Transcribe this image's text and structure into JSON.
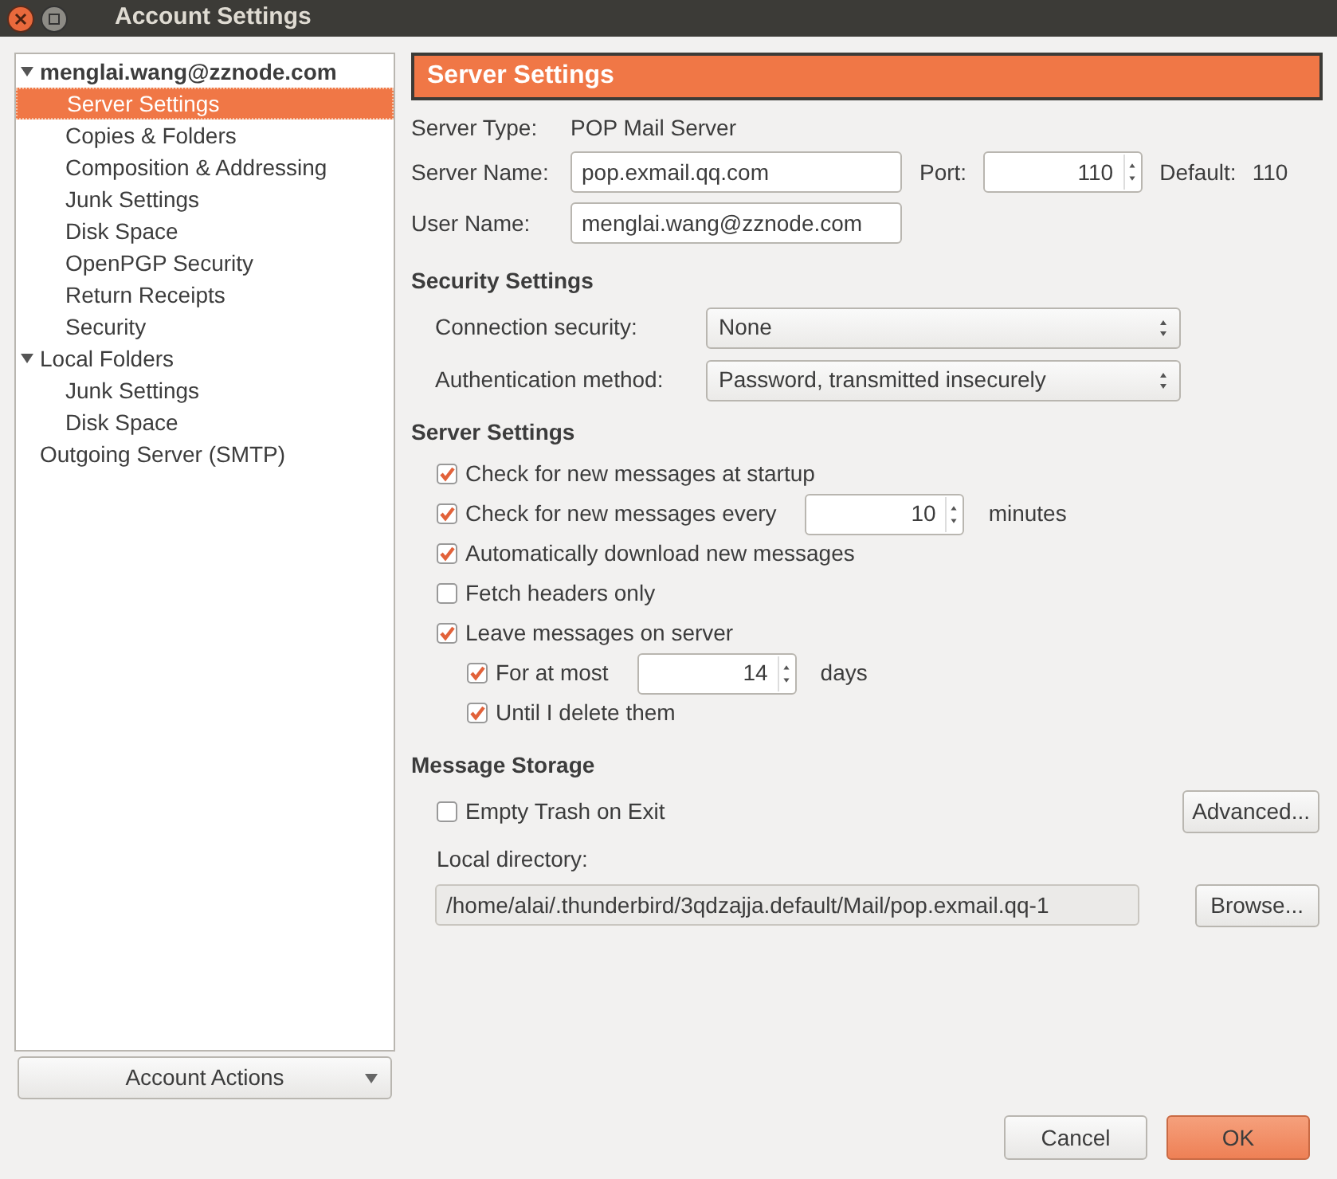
{
  "window": {
    "title": "Account Settings"
  },
  "sidebar": {
    "tree": [
      {
        "label": "menglai.wang@zznode.com",
        "expanded": true,
        "selected": false,
        "children": [
          {
            "label": "Server Settings",
            "selected": true
          },
          {
            "label": "Copies & Folders",
            "selected": false
          },
          {
            "label": "Composition & Addressing",
            "selected": false
          },
          {
            "label": "Junk Settings",
            "selected": false
          },
          {
            "label": "Disk Space",
            "selected": false
          },
          {
            "label": "OpenPGP Security",
            "selected": false
          },
          {
            "label": "Return Receipts",
            "selected": false
          },
          {
            "label": "Security",
            "selected": false
          }
        ]
      },
      {
        "label": "Local Folders",
        "expanded": true,
        "selected": false,
        "children": [
          {
            "label": "Junk Settings",
            "selected": false
          },
          {
            "label": "Disk Space",
            "selected": false
          }
        ]
      },
      {
        "label": "Outgoing Server (SMTP)",
        "selected": false
      }
    ],
    "account_actions": "Account Actions"
  },
  "panel": {
    "title": "Server Settings",
    "server_type": {
      "label": "Server Type:",
      "value": "POP Mail Server"
    },
    "server_name": {
      "label": "Server Name:",
      "value": "pop.exmail.qq.com"
    },
    "port": {
      "label": "Port:",
      "value": "110",
      "default_label": "Default:",
      "default_value": "110"
    },
    "user_name": {
      "label": "User Name:",
      "value": "menglai.wang@zznode.com"
    },
    "security": {
      "heading": "Security Settings",
      "selects": [
        {
          "label": "Connection security:",
          "value": "None"
        },
        {
          "label": "Authentication method:",
          "value": "Password, transmitted insecurely"
        }
      ]
    },
    "server_settings": {
      "heading": "Server Settings",
      "options": [
        {
          "kind": "checkbox",
          "label": "Check for new messages at startup",
          "checked": true
        },
        {
          "kind": "checkbox_spin",
          "label": "Check for new messages every",
          "checked": true,
          "value": "10",
          "unit": "minutes"
        },
        {
          "kind": "checkbox",
          "label": "Automatically download new messages",
          "checked": true
        },
        {
          "kind": "checkbox",
          "label": "Fetch headers only",
          "checked": false
        },
        {
          "kind": "checkbox",
          "label": "Leave messages on server",
          "checked": true,
          "children": [
            {
              "kind": "checkbox_spin",
              "label": "For at most",
              "checked": true,
              "value": "14",
              "unit": "days"
            },
            {
              "kind": "checkbox",
              "label": "Until I delete them",
              "checked": true
            }
          ]
        }
      ]
    },
    "message_storage": {
      "heading": "Message Storage",
      "empty_trash": {
        "label": "Empty Trash on Exit",
        "checked": false
      },
      "advanced": "Advanced...",
      "local_directory_label": "Local directory:",
      "local_directory": "/home/alai/.thunderbird/3qdzajja.default/Mail/pop.exmail.qq-1",
      "browse": "Browse..."
    }
  },
  "buttons": {
    "cancel": "Cancel",
    "ok": "OK"
  }
}
